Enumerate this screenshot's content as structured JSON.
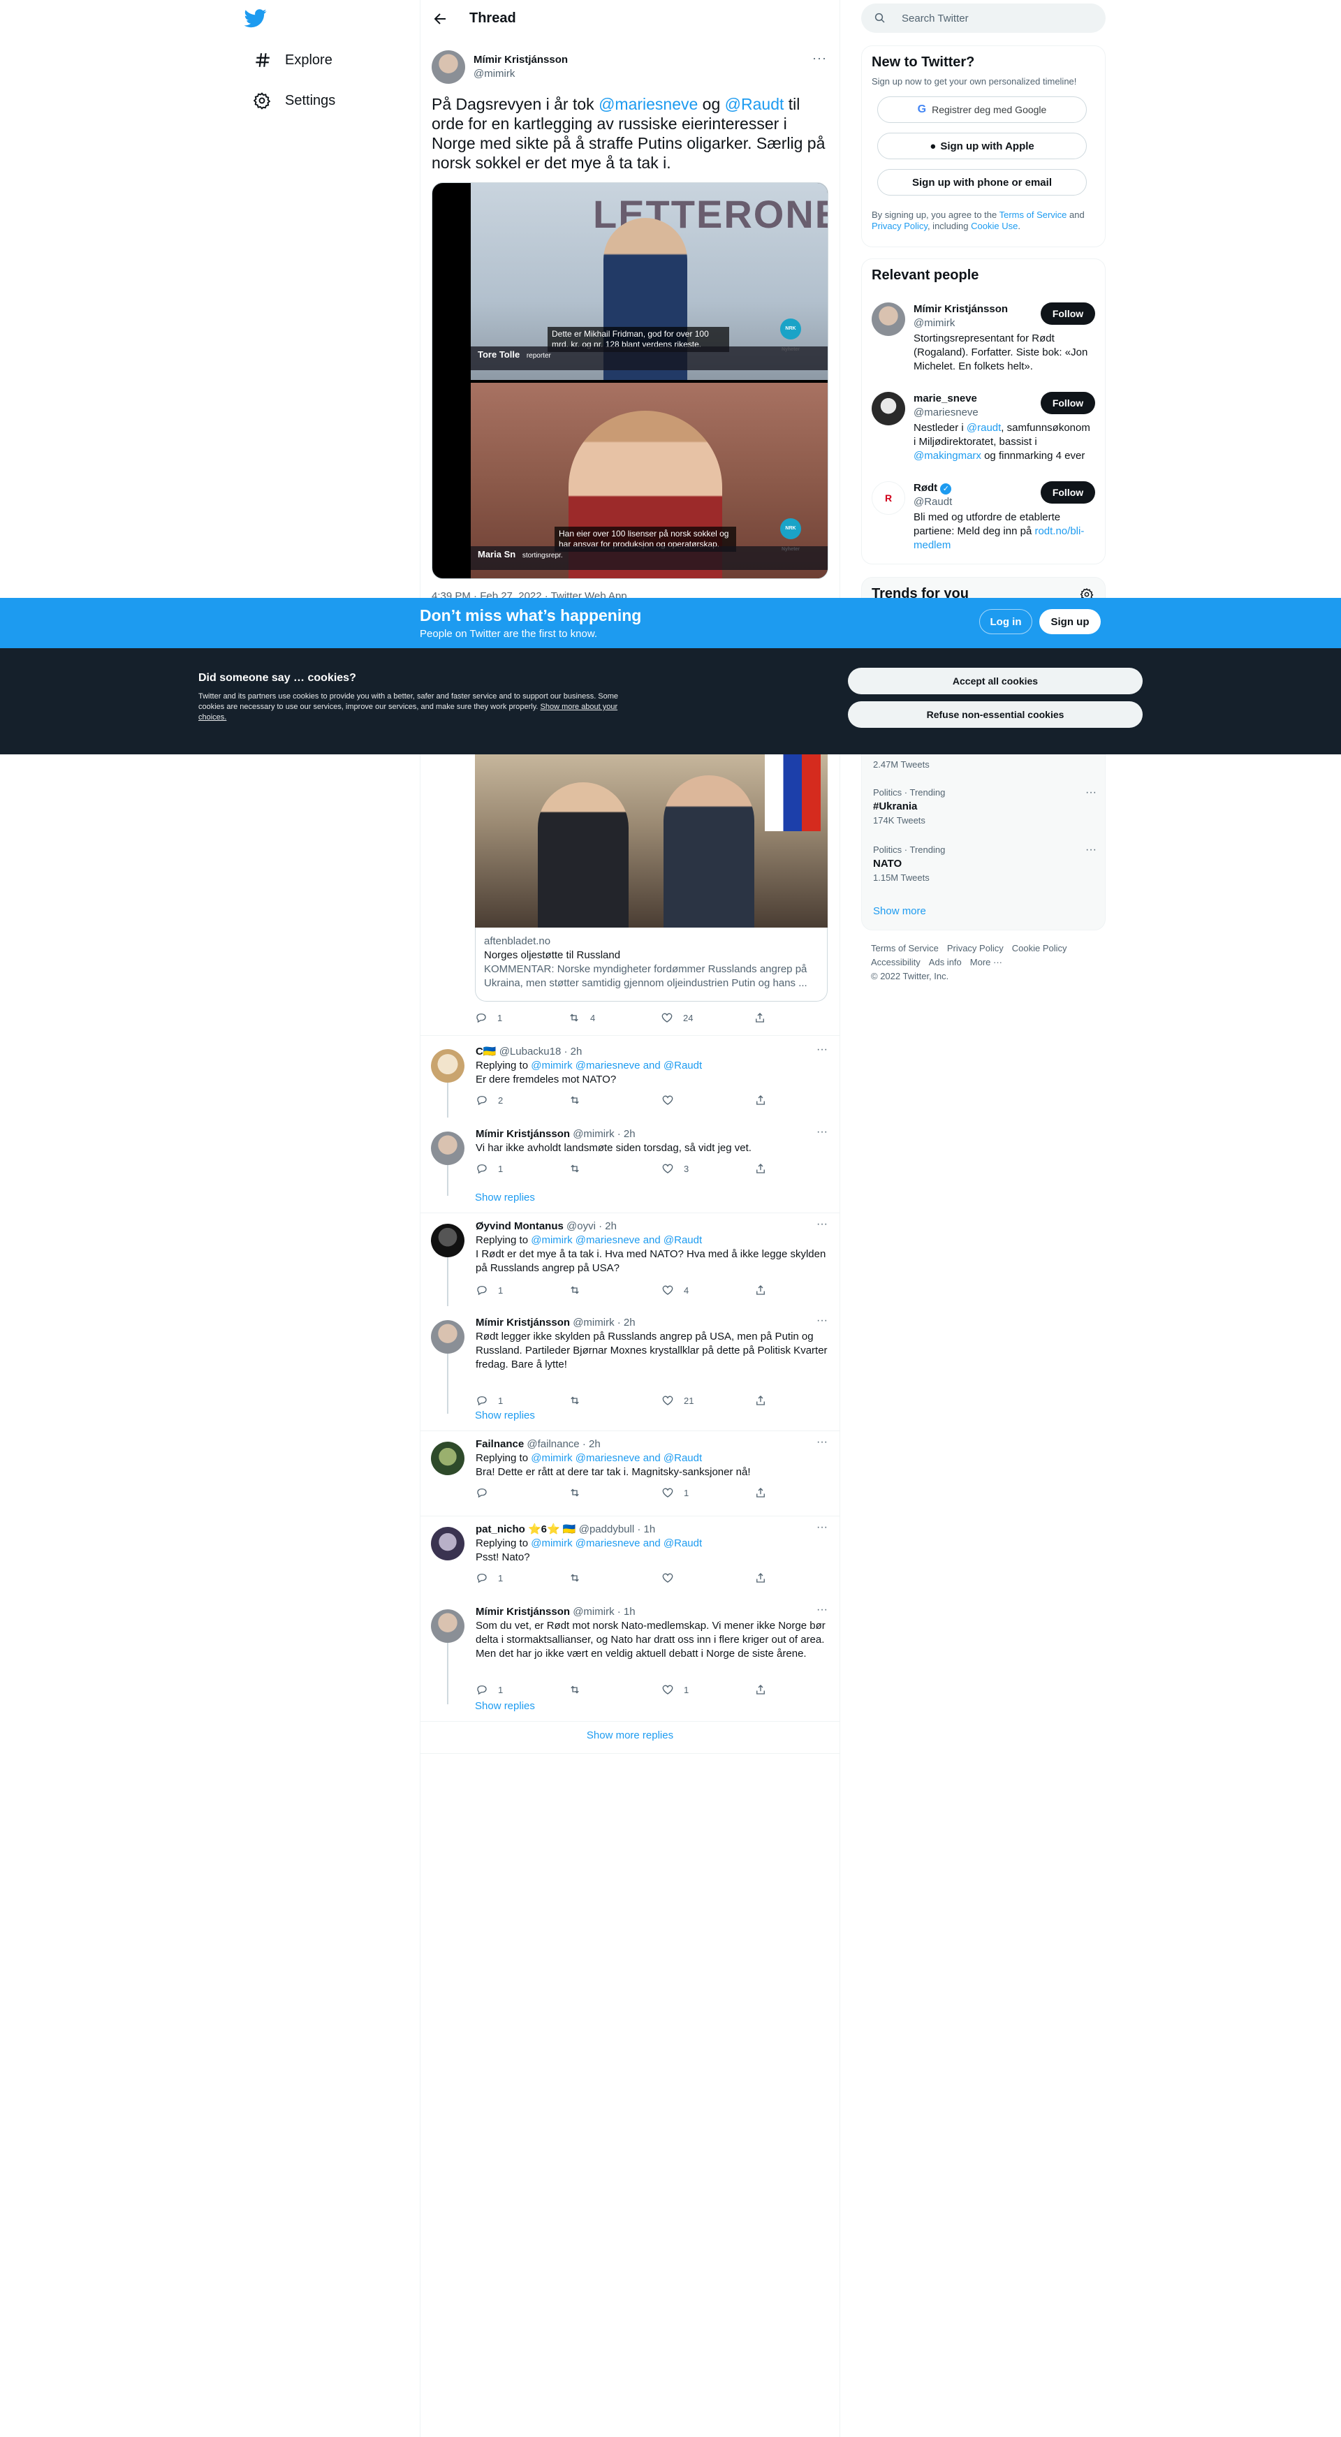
{
  "nav": {
    "explore": "Explore",
    "settings": "Settings"
  },
  "thread": {
    "header": "Thread",
    "author_name": "Mímir Kristjánsson",
    "author_handle": "@mimirk",
    "text_before": "På Dagsrevyen i år tok ",
    "mention1": "@mariesneve",
    "text_mid": " og ",
    "mention2": "@Raudt",
    "text_after": " til orde for en kartlegging av russiske eierinteresser i Norge med sikte på å straffe Putins oligarker. Særlig på norsk sokkel er det mye å ta tak i.",
    "timestamp": "4:39 PM · Feb 27, 2022 · Twitter Web App",
    "video": {
      "brand_text": "LETTERONE",
      "name1": "Tore Tolle",
      "role1": "reporter",
      "sub1": "Dette er Mikhail Fridman, god for over 100 mrd. kr. og nr. 128 blant verdens rikeste.",
      "name2": "Maria Sn",
      "role2": "stortingsrepr.",
      "sub2": "Han eier over 100 lisenser på norsk sokkel og har ansvar for produksjon og operatørskap.",
      "badge": "NRK Nyheter"
    }
  },
  "link_card": {
    "domain": "aftenbladet.no",
    "title": "Norges oljestøtte til Russland",
    "description": "KOMMENTAR: Norske myndigheter fordømmer Russlands angrep på Ukraina, men støtter samtidig gjennom oljeindustrien Putin og hans ...",
    "actions": {
      "reply": "1",
      "retweet": "4",
      "like": "24"
    }
  },
  "replies": [
    {
      "name": "C🇺🇦",
      "handle": "@Lubacku18 · 2h",
      "replying": "Replying to ",
      "to": "@mimirk @mariesneve and @Raudt",
      "text": "Er dere fremdeles mot NATO?",
      "reply": "2",
      "retweet": "",
      "like": ""
    },
    {
      "name": "Mímir Kristjánsson",
      "handle": "@mimirk · 2h",
      "text": "Vi har ikke avholdt landsmøte siden torsdag, så vidt jeg vet.",
      "reply": "1",
      "retweet": "",
      "like": "3"
    },
    {
      "name": "Øyvind Montanus",
      "handle": "@oyvi · 2h",
      "replying": "Replying to ",
      "to": "@mimirk @mariesneve and @Raudt",
      "text": "I Rødt er det mye å ta tak i. Hva med NATO? Hva med å ikke legge skylden på Russlands angrep på USA?",
      "reply": "1",
      "retweet": "",
      "like": "4"
    },
    {
      "name": "Mímir Kristjánsson",
      "handle": "@mimirk · 2h",
      "text": "Rødt legger ikke skylden på Russlands angrep på USA, men på Putin og Russland. Partileder Bjørnar Moxnes krystallklar på dette på Politisk Kvarter fredag. Bare å lytte!",
      "reply": "1",
      "retweet": "",
      "like": "21"
    },
    {
      "name": "Failnance",
      "handle": "@failnance · 2h",
      "replying": "Replying to ",
      "to": "@mimirk @mariesneve and @Raudt",
      "text": "Bra! Dette er rått at dere tar tak i. Magnitsky-sanksjoner nå!",
      "reply": "",
      "retweet": "",
      "like": "1"
    },
    {
      "name": "pat_nicho ⭐6⭐ 🇺🇦",
      "handle": "@paddybull · 1h",
      "replying": "Replying to ",
      "to": "@mimirk @mariesneve and @Raudt",
      "text": "Psst! Nato?",
      "reply": "1",
      "retweet": "",
      "like": ""
    },
    {
      "name": "Mímir Kristjánsson",
      "handle": "@mimirk · 1h",
      "text": "Som du vet, er Rødt mot norsk Nato-medlemskap. Vi mener ikke Norge bør delta i stormaktsallianser, og Nato har dratt oss inn i flere kriger out of area. Men det har jo ikke vært en veldig aktuell debatt i Norge de siste årene.",
      "reply": "1",
      "retweet": "",
      "like": "1"
    }
  ],
  "show_replies": "Show replies",
  "show_more_replies": "Show more replies",
  "search": {
    "placeholder": "Search Twitter"
  },
  "new_to_twitter": {
    "title": "New to Twitter?",
    "sub": "Sign up now to get your own personalized timeline!",
    "google": "Registrer deg med Google",
    "apple": "Sign up with Apple",
    "phone": "Sign up with phone or email",
    "legal1": "By signing up, you agree to the ",
    "tos": "Terms of Service",
    "legal2": " and ",
    "privacy": "Privacy Policy",
    "legal3": ", including ",
    "cookie": "Cookie Use",
    "legal4": "."
  },
  "relevant": {
    "title": "Relevant people",
    "follow": "Follow",
    "people": [
      {
        "name": "Mímir Kristjánsson",
        "handle": "@mimirk",
        "bio": "Stortingsrepresentant for Rødt (Rogaland). Forfatter. Siste bok: «Jon Michelet. En folkets helt»."
      },
      {
        "name": "marie_sneve",
        "handle": "@mariesneve",
        "bio1": "Nestleder i ",
        "bio_link1": "@raudt",
        "bio2": ", samfunnsøkonom i Miljødirektoratet, bassist i ",
        "bio_link2": "@makingmarx",
        "bio3": " og finnmarking 4 ever"
      },
      {
        "name": "Rødt",
        "handle": "@Raudt",
        "bio1": "Bli med og utfordre de etablerte partiene: Meld deg inn på ",
        "bio_link": "rodt.no/bli-medlem"
      }
    ]
  },
  "trends": {
    "title": "Trends for you",
    "items": [
      {
        "count": "2.47M Tweets"
      },
      {
        "category": "Politics · Trending",
        "topic": "#Ukrania",
        "count": "174K Tweets"
      },
      {
        "category": "Politics · Trending",
        "topic": "NATO",
        "count": "1.15M Tweets"
      }
    ],
    "show_more": "Show more"
  },
  "footer": {
    "links": [
      "Terms of Service",
      "Privacy Policy",
      "Cookie Policy",
      "Accessibility",
      "Ads info",
      "More ···"
    ],
    "copyright": "© 2022 Twitter, Inc."
  },
  "signup_bar": {
    "title": "Don’t miss what’s happening",
    "sub": "People on Twitter are the first to know.",
    "login": "Log in",
    "signup": "Sign up"
  },
  "cookie": {
    "title": "Did someone say … cookies?",
    "body": "Twitter and its partners use cookies to provide you with a better, safer and faster service and to support our business. Some cookies are necessary to use our services, improve our services, and make sure they work properly. ",
    "link": "Show more about your choices.",
    "accept": "Accept all cookies",
    "refuse": "Refuse non-essential cookies"
  },
  "colors": {
    "accent": "#1d9bf0",
    "dark": "#0f1419",
    "cookie_bg": "#15202b"
  }
}
